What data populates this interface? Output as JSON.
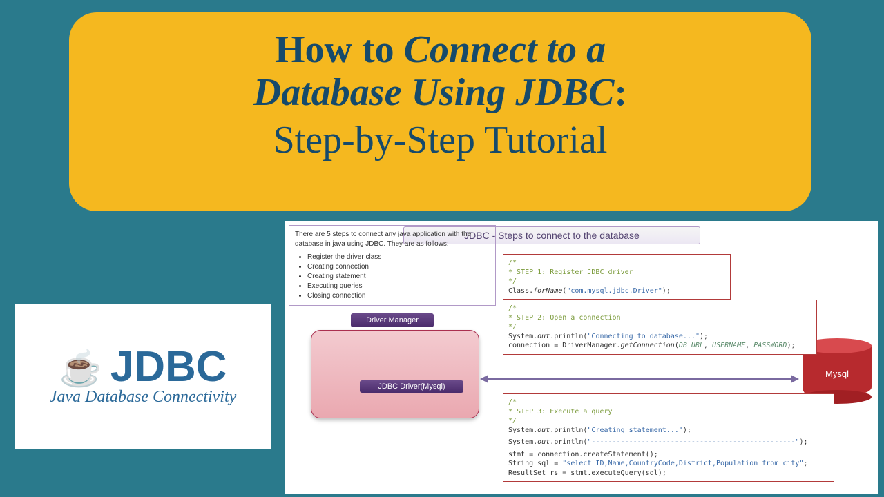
{
  "title": {
    "line1_plain": "How to ",
    "line1_italic": "Connect to a",
    "line2_italic": "Database Using JDBC",
    "line2_colon": ":",
    "line3": "Step-by-Step Tutorial"
  },
  "logo": {
    "acronym": "JDBC",
    "subtitle": "Java Database Connectivity"
  },
  "diagram": {
    "header": "JDBC - Steps to connect to the database",
    "intro": "There are 5 steps to connect any java application with the database in java using JDBC. They are as follows:",
    "steps": [
      "Register the driver class",
      "Creating connection",
      "Creating statement",
      "Executing queries",
      "Closing connection"
    ],
    "driver_manager": "Driver Manager",
    "driver_inner": "JDBC Driver(Mysql)",
    "db_label": "Mysql",
    "code1": {
      "c1": "/*",
      "c2": " * STEP 1: Register JDBC driver",
      "c3": " */",
      "l1a": "Class.",
      "l1b": "forName",
      "l1c": "(",
      "l1d": "\"com.mysql.jdbc.Driver\"",
      "l1e": ");"
    },
    "code2": {
      "c1": "/*",
      "c2": " * STEP 2: Open a connection",
      "c3": " */",
      "l1a": "System.",
      "l1b": "out",
      "l1c": ".println(",
      "l1d": "\"Connecting to database...\"",
      "l1e": ");",
      "l2a": "connection = DriverManager.",
      "l2b": "getConnection",
      "l2c": "(",
      "l2d": "DB_URL",
      "l2e": ", ",
      "l2f": "USERNAME",
      "l2g": ", ",
      "l2h": "PASSWORD",
      "l2i": ");"
    },
    "code3": {
      "c1": "/*",
      "c2": " * STEP 3: Execute a query",
      "c3": " */",
      "l1a": "System.",
      "l1b": "out",
      "l1c": ".println(",
      "l1d": "\"Creating statement...\"",
      "l1e": ");",
      "l2a": "System.",
      "l2b": "out",
      "l2c": ".println(",
      "l2d": "\"-------------------------------------------------\"",
      "l2e": ");",
      "l3": "stmt = connection.createStatement();",
      "l4a": "String sql = ",
      "l4b": "\"select ID,Name,CountryCode,District,Population from city\"",
      "l4c": ";",
      "l5": "ResultSet rs = stmt.executeQuery(sql);"
    }
  }
}
